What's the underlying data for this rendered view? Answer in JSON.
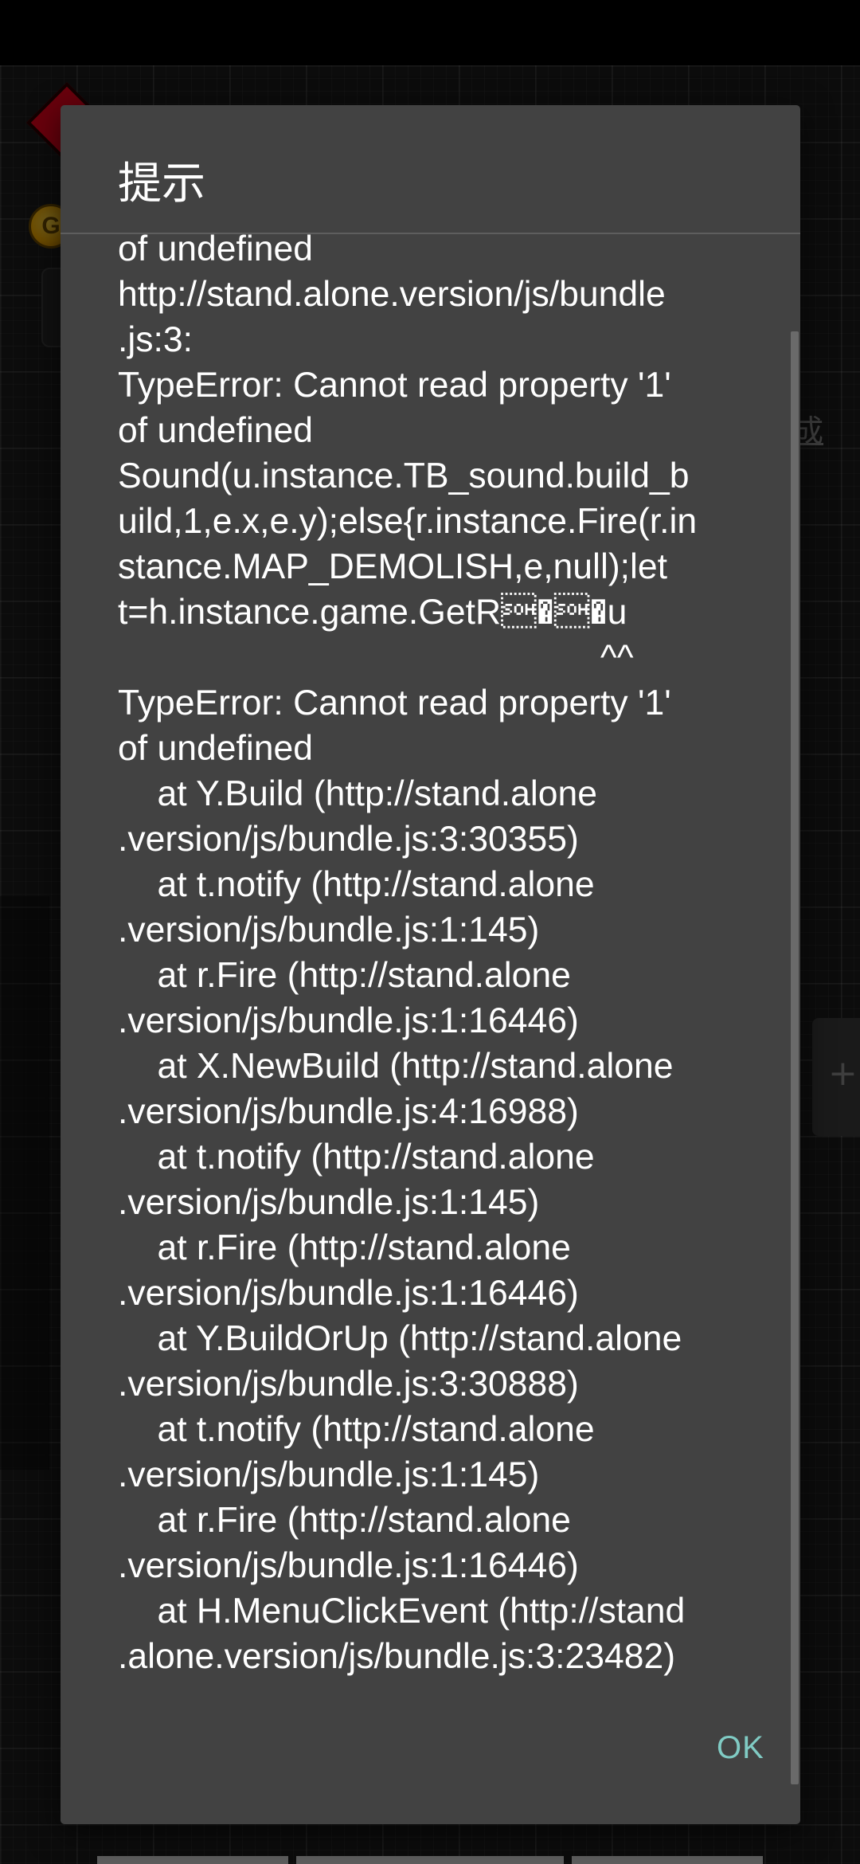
{
  "dialog": {
    "title": "提示",
    "message": "of undefined\nhttp://stand.alone.version/js/bundle\n.js:3:\nTypeError: Cannot read property '1'\nof undefined\nSound(u.instance.TB_sound.build_b\nuild,1,e.x,e.y);else{r.instance.Fire(r.in\nstance.MAP_DEMOLISH,e,null);let\nt=h.instance.game.GetR\u0001�\u0001�u\n                                                 ^^\nTypeError: Cannot read property '1'\nof undefined\n    at Y.Build (http://stand.alone\n.version/js/bundle.js:3:30355)\n    at t.notify (http://stand.alone\n.version/js/bundle.js:1:145)\n    at r.Fire (http://stand.alone\n.version/js/bundle.js:1:16446)\n    at X.NewBuild (http://stand.alone\n.version/js/bundle.js:4:16988)\n    at t.notify (http://stand.alone\n.version/js/bundle.js:1:145)\n    at r.Fire (http://stand.alone\n.version/js/bundle.js:1:16446)\n    at Y.BuildOrUp (http://stand.alone\n.version/js/bundle.js:3:30888)\n    at t.notify (http://stand.alone\n.version/js/bundle.js:1:145)\n    at r.Fire (http://stand.alone\n.version/js/bundle.js:1:16446)\n    at H.MenuClickEvent (http://stand\n.alone.version/js/bundle.js:3:23482)",
    "ok_label": "OK",
    "ok_color": "#80cbc4",
    "background_color": "#424242"
  },
  "background": {
    "coin_glyph": "G",
    "link_text": "成",
    "plus_glyph": "+",
    "red_marker_color": "#e8001c",
    "coin_color": "#f0a800"
  }
}
